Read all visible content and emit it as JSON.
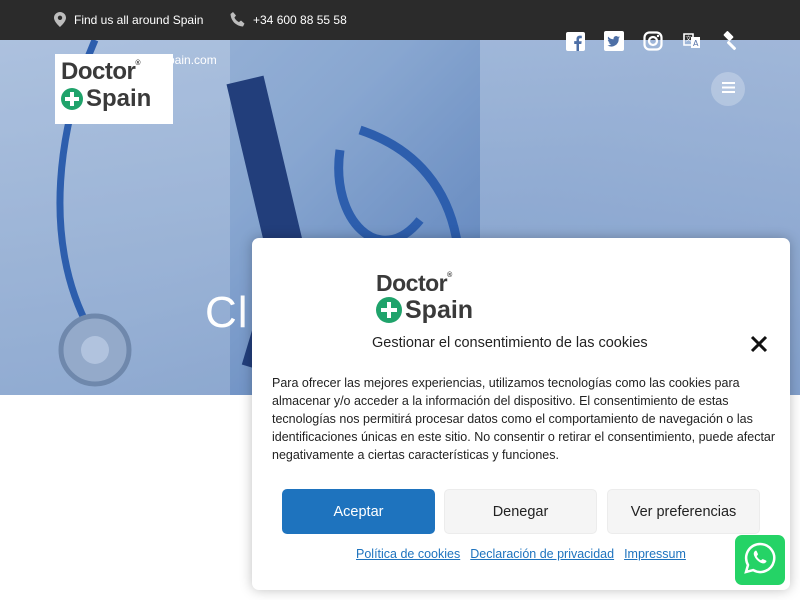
{
  "topbar": {
    "location_text": "Find us all around Spain",
    "phone_text": "+34 600 88 55 58",
    "location_icon": "map-pin-icon",
    "phone_icon": "phone-icon"
  },
  "header": {
    "email_partial": "pain.com",
    "logo": {
      "line1": "Doctor",
      "line2": "Spain",
      "mark": "®"
    },
    "socials": [
      "facebook-icon",
      "twitter-icon",
      "instagram-icon",
      "translate-icon",
      "gavel-icon"
    ],
    "menu_icon": "hamburger-icon"
  },
  "hero": {
    "title_partial": "Cl"
  },
  "cookie_modal": {
    "logo": {
      "line1": "Doctor",
      "line2": "Spain",
      "mark": "®"
    },
    "title": "Gestionar el consentimiento de las cookies",
    "body": "Para ofrecer las mejores experiencias, utilizamos tecnologías como las cookies para almacenar y/o acceder a la información del dispositivo. El consentimiento de estas tecnologías nos permitirá procesar datos como el comportamiento de navegación o las identificaciones únicas en este sitio. No consentir o retirar el consentimiento, puede afectar negativamente a ciertas características y funciones.",
    "buttons": {
      "accept": "Aceptar",
      "deny": "Denegar",
      "preferences": "Ver preferencias"
    },
    "links": {
      "cookies": "Política de cookies",
      "privacy": "Declaración de privacidad",
      "impressum": "Impressum"
    }
  },
  "colors": {
    "accent": "#1e73be",
    "brand_green": "#1fa36b",
    "topbar": "#2b2b2b",
    "whatsapp": "#25d366"
  }
}
